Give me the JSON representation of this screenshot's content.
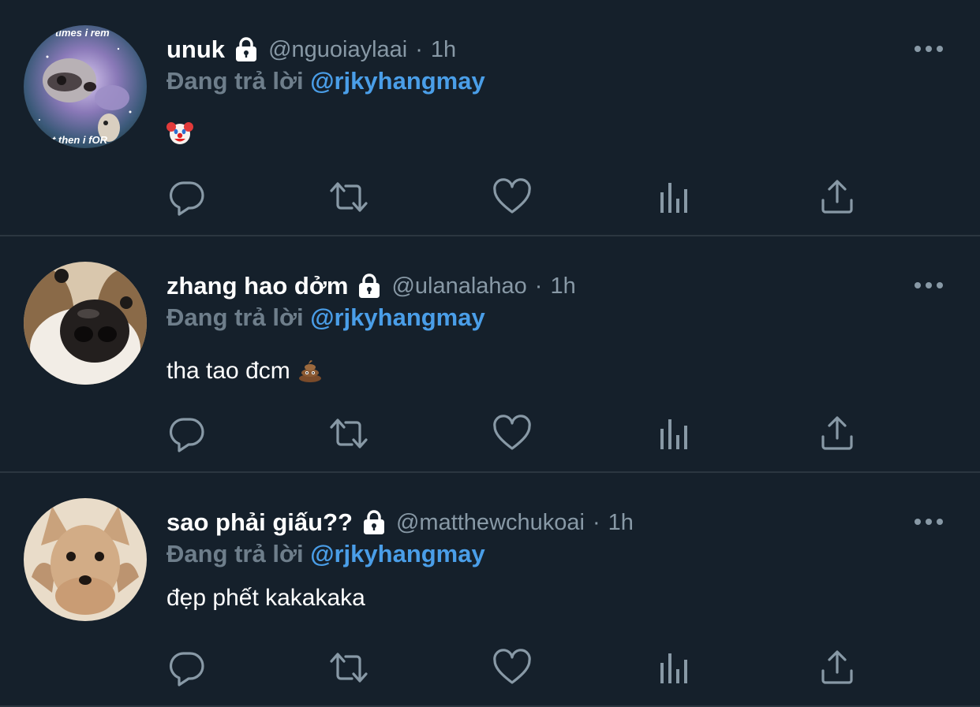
{
  "feed": {
    "tweets": [
      {
        "display_name": "unuk",
        "handle": "@nguoiaylaai",
        "separator": "·",
        "time": "1h",
        "reply_prefix": "Đang trả lời",
        "reply_to": "@rjkyhangmay",
        "text": "",
        "emoji": "clown-face",
        "avatar": {
          "caption_top": "times i rem",
          "caption_bottom": "ut then i fOR",
          "subject": "raccoon-galaxy-meme"
        }
      },
      {
        "display_name": "zhang hao dởm",
        "handle": "@ulanalahao",
        "separator": "·",
        "time": "1h",
        "reply_prefix": "Đang trả lời",
        "reply_to": "@rjkyhangmay",
        "text": "tha tao đcm",
        "emoji": "pile-of-poo",
        "avatar": {
          "subject": "dog-nose-closeup"
        }
      },
      {
        "display_name": "sao phải giấu??",
        "handle": "@matthewchukoai",
        "separator": "·",
        "time": "1h",
        "reply_prefix": "Đang trả lời",
        "reply_to": "@rjkyhangmay",
        "text": "đẹp phết kakakaka",
        "emoji": "",
        "avatar": {
          "subject": "chihuahua-portrait"
        }
      }
    ]
  },
  "icons": {
    "reply": "reply-icon",
    "retweet": "retweet-icon",
    "like": "like-icon",
    "analytics": "analytics-icon",
    "share": "share-icon",
    "more": "more-icon",
    "lock": "lock-icon"
  },
  "colors": {
    "background": "#15202b",
    "divider": "#2b3640",
    "muted": "#8899a6",
    "mention": "#4a9ee8",
    "text": "#ffffff"
  }
}
